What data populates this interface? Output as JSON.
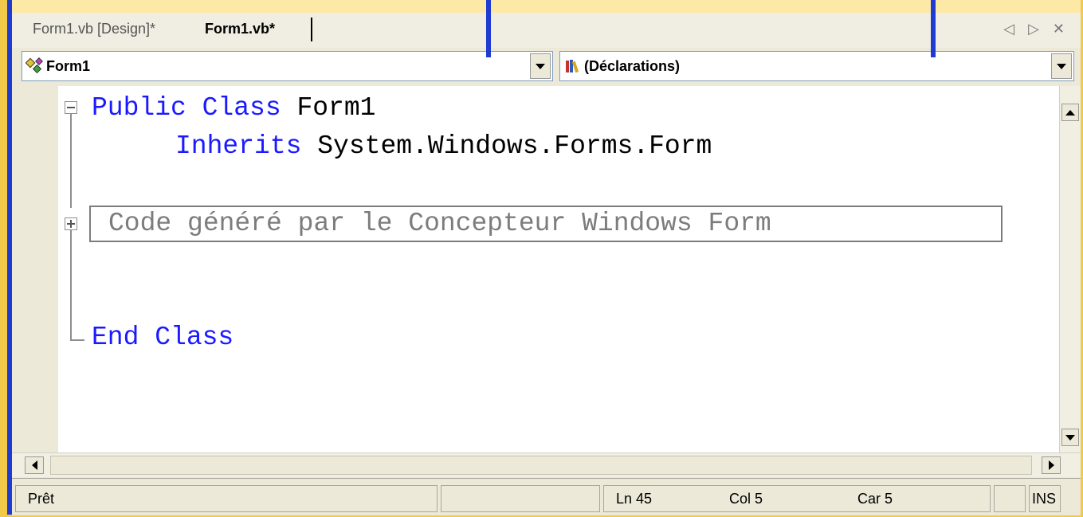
{
  "tabs": [
    {
      "label": "Form1.vb [Design]*",
      "active": false
    },
    {
      "label": "Form1.vb*",
      "active": true
    }
  ],
  "tab_controls": "◁ ▷ ✕",
  "class_combo": {
    "value": "Form1",
    "icon": "class-icon"
  },
  "member_combo": {
    "value": "(Déclarations)",
    "icon": "declarations-icon"
  },
  "code": {
    "line1": {
      "keywords": "Public Class",
      "name": "Form1"
    },
    "line2": {
      "keyword": "Inherits",
      "name": "System.Windows.Forms.Form"
    },
    "region_label": "Code généré par le Concepteur Windows Form",
    "line_end": "End Class"
  },
  "status": {
    "message": "Prêt",
    "line": "Ln 45",
    "column": "Col 5",
    "char": "Car 5",
    "mode": "INS"
  },
  "colors": {
    "keyword": "#1A1AFF",
    "region": "#7C7C7C",
    "callout": "#1F3BD1",
    "background": "#FDE9A6"
  }
}
